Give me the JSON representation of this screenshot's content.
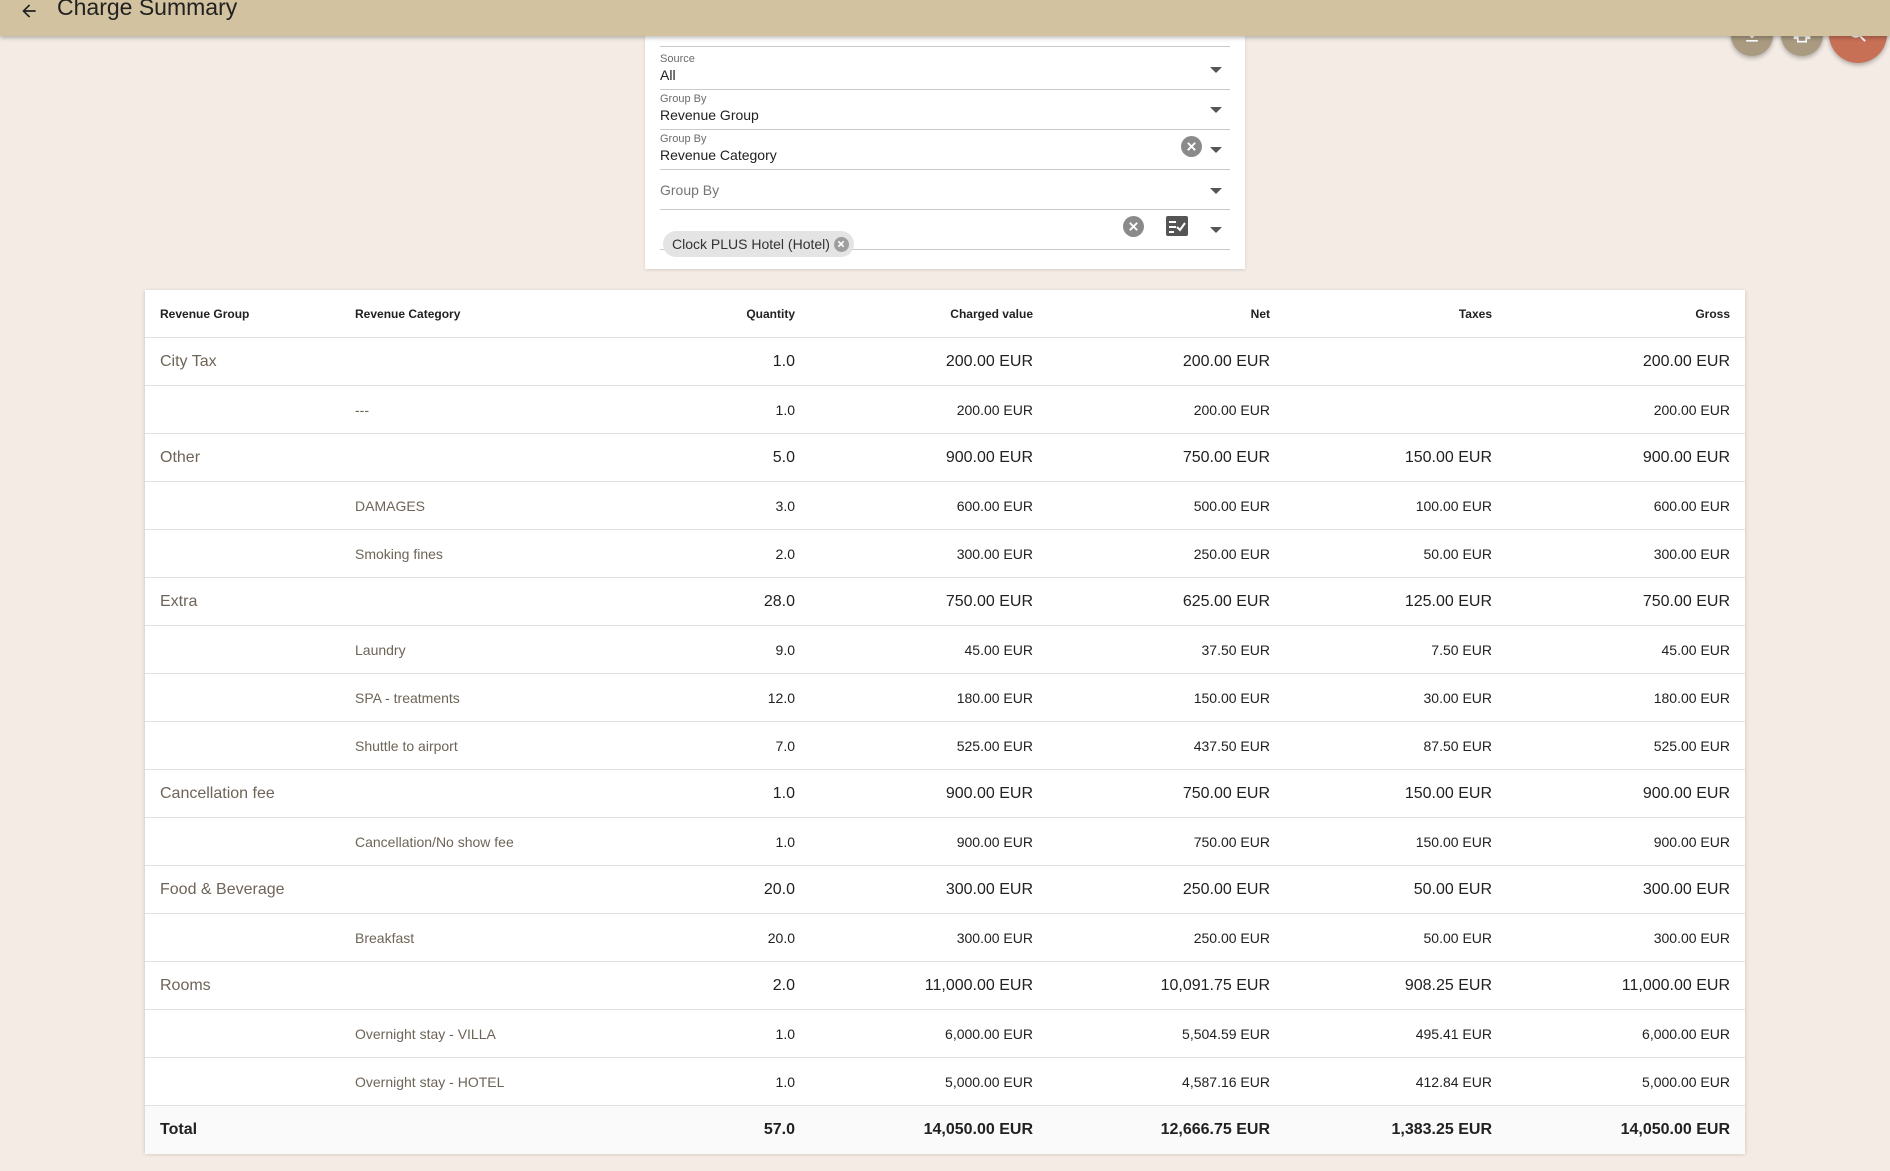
{
  "app_bar": {
    "title": "Charge Summary",
    "back_icon": "arrow-left-icon",
    "color": "#d2c29f"
  },
  "actions": {
    "download_icon": "download-icon",
    "print_icon": "print-icon",
    "search_icon": "search-icon",
    "search_color": "#c87056"
  },
  "filters": {
    "source": {
      "label": "Source",
      "value": "All"
    },
    "group_by_1": {
      "label": "Group By",
      "value": "Revenue Group"
    },
    "group_by_2": {
      "label": "Group By",
      "value": "Revenue Category"
    },
    "group_by_3": {
      "placeholder": "Group By"
    },
    "property": {
      "chips": [
        "Clock PLUS Hotel (Hotel)"
      ]
    }
  },
  "table": {
    "columns": {
      "group": "Revenue Group",
      "category": "Revenue Category",
      "quantity": "Quantity",
      "charged": "Charged value",
      "net": "Net",
      "taxes": "Taxes",
      "gross": "Gross"
    },
    "rows": [
      {
        "kind": "group",
        "group": "City Tax",
        "category": "",
        "quantity": "1.0",
        "charged": "200.00 EUR",
        "net": "200.00 EUR",
        "taxes": "",
        "gross": "200.00 EUR"
      },
      {
        "kind": "sub",
        "group": "",
        "category": "---",
        "quantity": "1.0",
        "charged": "200.00 EUR",
        "net": "200.00 EUR",
        "taxes": "",
        "gross": "200.00 EUR"
      },
      {
        "kind": "group",
        "group": "Other",
        "category": "",
        "quantity": "5.0",
        "charged": "900.00 EUR",
        "net": "750.00 EUR",
        "taxes": "150.00 EUR",
        "gross": "900.00 EUR"
      },
      {
        "kind": "sub",
        "group": "",
        "category": "DAMAGES",
        "quantity": "3.0",
        "charged": "600.00 EUR",
        "net": "500.00 EUR",
        "taxes": "100.00 EUR",
        "gross": "600.00 EUR"
      },
      {
        "kind": "sub",
        "group": "",
        "category": "Smoking fines",
        "quantity": "2.0",
        "charged": "300.00 EUR",
        "net": "250.00 EUR",
        "taxes": "50.00 EUR",
        "gross": "300.00 EUR"
      },
      {
        "kind": "group",
        "group": "Extra",
        "category": "",
        "quantity": "28.0",
        "charged": "750.00 EUR",
        "net": "625.00 EUR",
        "taxes": "125.00 EUR",
        "gross": "750.00 EUR"
      },
      {
        "kind": "sub",
        "group": "",
        "category": "Laundry",
        "quantity": "9.0",
        "charged": "45.00 EUR",
        "net": "37.50 EUR",
        "taxes": "7.50 EUR",
        "gross": "45.00 EUR"
      },
      {
        "kind": "sub",
        "group": "",
        "category": "SPA - treatments",
        "quantity": "12.0",
        "charged": "180.00 EUR",
        "net": "150.00 EUR",
        "taxes": "30.00 EUR",
        "gross": "180.00 EUR"
      },
      {
        "kind": "sub",
        "group": "",
        "category": "Shuttle to airport",
        "quantity": "7.0",
        "charged": "525.00 EUR",
        "net": "437.50 EUR",
        "taxes": "87.50 EUR",
        "gross": "525.00 EUR"
      },
      {
        "kind": "group",
        "group": "Cancellation fee",
        "category": "",
        "quantity": "1.0",
        "charged": "900.00 EUR",
        "net": "750.00 EUR",
        "taxes": "150.00 EUR",
        "gross": "900.00 EUR"
      },
      {
        "kind": "sub",
        "group": "",
        "category": "Cancellation/No show fee",
        "quantity": "1.0",
        "charged": "900.00 EUR",
        "net": "750.00 EUR",
        "taxes": "150.00 EUR",
        "gross": "900.00 EUR"
      },
      {
        "kind": "group",
        "group": "Food & Beverage",
        "category": "",
        "quantity": "20.0",
        "charged": "300.00 EUR",
        "net": "250.00 EUR",
        "taxes": "50.00 EUR",
        "gross": "300.00 EUR"
      },
      {
        "kind": "sub",
        "group": "",
        "category": "Breakfast",
        "quantity": "20.0",
        "charged": "300.00 EUR",
        "net": "250.00 EUR",
        "taxes": "50.00 EUR",
        "gross": "300.00 EUR"
      },
      {
        "kind": "group",
        "group": "Rooms",
        "category": "",
        "quantity": "2.0",
        "charged": "11,000.00 EUR",
        "net": "10,091.75 EUR",
        "taxes": "908.25 EUR",
        "gross": "11,000.00 EUR"
      },
      {
        "kind": "sub",
        "group": "",
        "category": "Overnight stay - VILLA",
        "quantity": "1.0",
        "charged": "6,000.00 EUR",
        "net": "5,504.59 EUR",
        "taxes": "495.41 EUR",
        "gross": "6,000.00 EUR"
      },
      {
        "kind": "sub",
        "group": "",
        "category": "Overnight stay - HOTEL",
        "quantity": "1.0",
        "charged": "5,000.00 EUR",
        "net": "4,587.16 EUR",
        "taxes": "412.84 EUR",
        "gross": "5,000.00 EUR"
      }
    ],
    "total": {
      "label": "Total",
      "quantity": "57.0",
      "charged": "14,050.00 EUR",
      "net": "12,666.75 EUR",
      "taxes": "1,383.25 EUR",
      "gross": "14,050.00 EUR"
    }
  }
}
